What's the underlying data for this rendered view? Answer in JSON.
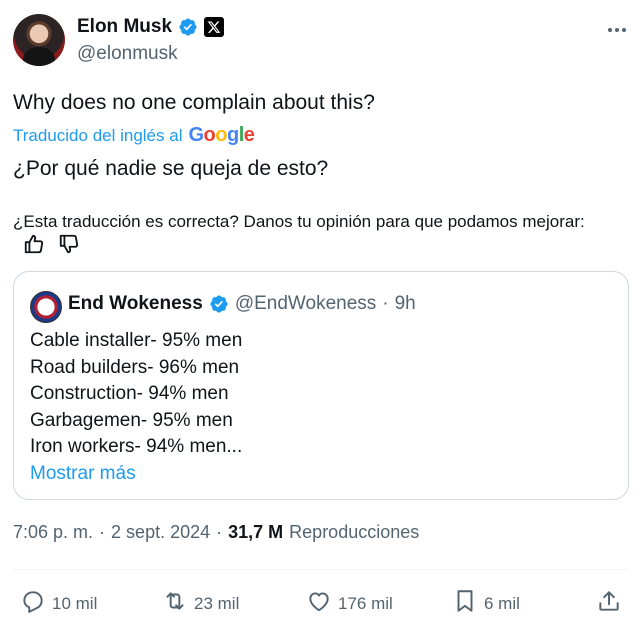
{
  "author": {
    "name": "Elon Musk",
    "handle": "@elonmusk"
  },
  "icons": {
    "verified": "verified-badge-icon",
    "affiliate": "x-logo-icon",
    "more": "more-options-icon"
  },
  "tweet": {
    "text": "Why does no one complain about this?",
    "translated_by": "Traducido del inglés al",
    "translator_brand": "Google",
    "translated_text": "¿Por qué nadie se queja de esto?",
    "feedback_text": "¿Esta traducción es correcta? Danos tu opinión para que podamos mejorar:"
  },
  "quote": {
    "name": "End Wokeness",
    "handle": "@EndWokeness",
    "separator": "·",
    "time": "9h",
    "lines": [
      "Cable installer- 95% men",
      "Road builders- 96% men",
      "Construction- 94% men",
      "Garbagemen- 95% men",
      "Iron workers- 94% men..."
    ],
    "show_more": "Mostrar más"
  },
  "meta": {
    "time": "7:06 p. m.",
    "separator": "·",
    "date": "2 sept. 2024",
    "separator2": "·",
    "views": "31,7 M",
    "views_label": "Reproducciones"
  },
  "actions": {
    "replies": "10 mil",
    "reposts": "23 mil",
    "likes": "176 mil",
    "bookmarks": "6 mil"
  },
  "colors": {
    "accent": "#1d9bf0",
    "muted": "#536471",
    "text": "#0f1419",
    "border": "#cfd9de"
  }
}
